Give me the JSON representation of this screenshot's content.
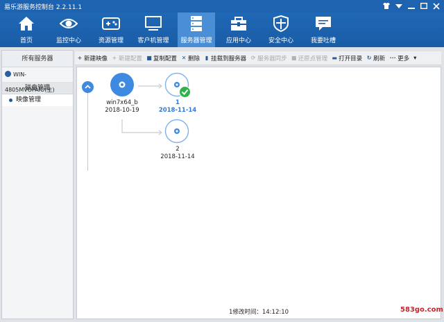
{
  "window": {
    "title": "易乐游服务控制台 2.2.11.1"
  },
  "nav": {
    "items": [
      {
        "label": "首页",
        "icon": "home-icon"
      },
      {
        "label": "监控中心",
        "icon": "eye-icon"
      },
      {
        "label": "资源管理",
        "icon": "gamepad-icon"
      },
      {
        "label": "客户机管理",
        "icon": "monitor-icon"
      },
      {
        "label": "服务器管理",
        "icon": "server-icon",
        "active": true
      },
      {
        "label": "应用中心",
        "icon": "toolbox-icon"
      },
      {
        "label": "安全中心",
        "icon": "shield-icon"
      },
      {
        "label": "我要吐槽",
        "icon": "chat-icon"
      }
    ]
  },
  "sidebar": {
    "header": "所有服务器",
    "server": "WIN-4805MVOPAIO(主)",
    "sub": "磁盘管理",
    "leaf": "映像管理"
  },
  "toolbar": {
    "items": [
      {
        "label": "新建映像",
        "glyph": "+",
        "enabled": true
      },
      {
        "label": "新建配置",
        "glyph": "+",
        "enabled": false
      },
      {
        "label": "复制配置",
        "glyph": "■",
        "enabled": true
      },
      {
        "label": "删除",
        "glyph": "✕",
        "enabled": true
      },
      {
        "label": "挂载到服务器",
        "glyph": "▮",
        "enabled": true
      },
      {
        "label": "服务器同步",
        "glyph": "⟳",
        "enabled": false
      },
      {
        "label": "还原点管理",
        "glyph": "■",
        "enabled": false
      },
      {
        "label": "打开目录",
        "glyph": "▬",
        "enabled": true
      },
      {
        "label": "刷新",
        "glyph": "↻",
        "enabled": true
      },
      {
        "label": "更多",
        "glyph": "···",
        "enabled": true
      }
    ],
    "more_arrow": "▾"
  },
  "tree": {
    "root": {
      "name": "win7x64_b",
      "date": "2018-10-19"
    },
    "child1": {
      "name": "1",
      "date": "2018-11-14",
      "status": "checked"
    },
    "child2": {
      "name": "2",
      "date": "2018-11-14"
    }
  },
  "status": {
    "text": "1修改时间：14:12:10"
  },
  "watermark": "583go.com",
  "colors": {
    "nav_bg": "#1a5ca6",
    "nav_active": "#4a8fd6",
    "accent": "#3d8ae0",
    "check": "#2eb34a"
  }
}
